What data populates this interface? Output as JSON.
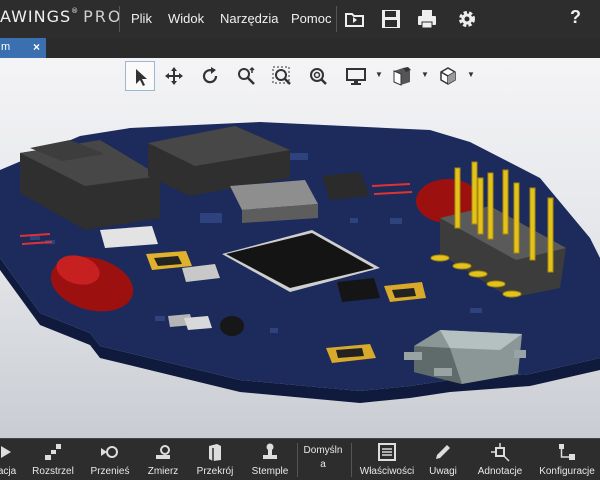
{
  "app": {
    "logo_main": "AWINGS",
    "logo_sup": "®",
    "logo_pro": "PRO"
  },
  "menu": {
    "items": [
      "Plik",
      "Widok",
      "Narzędzia",
      "Pomoc"
    ]
  },
  "toolbar": {
    "icons": [
      "open-folder-icon",
      "save-icon",
      "print-icon",
      "gear-icon"
    ],
    "help_label": "?"
  },
  "tab": {
    "label": "m",
    "close_label": "×"
  },
  "view_toolbar": {
    "tools": [
      "select-pointer-icon",
      "pan-icon",
      "rotate-icon",
      "zoom-icon",
      "zoom-window-icon",
      "zoom-fit-icon",
      "display-mode-icon",
      "render-mode-icon",
      "view-cube-icon"
    ]
  },
  "ribbon": {
    "items": [
      {
        "label": "acja",
        "icon": "animation-icon"
      },
      {
        "label": "Rozstrzel",
        "icon": "explode-icon"
      },
      {
        "label": "Przenieś",
        "icon": "move-icon"
      },
      {
        "label": "Zmierz",
        "icon": "measure-icon"
      },
      {
        "label": "Przekrój",
        "icon": "section-icon"
      },
      {
        "label": "Stemple",
        "icon": "stamp-icon"
      },
      {
        "label": "Domyśln\na",
        "icon": ""
      },
      {
        "label": "Właściwości",
        "icon": "properties-icon"
      },
      {
        "label": "Uwagi",
        "icon": "pencil-icon"
      },
      {
        "label": "Adnotacje",
        "icon": "annotation-icon"
      },
      {
        "label": "Konfiguracje",
        "icon": "configuration-icon"
      }
    ]
  },
  "colors": {
    "background": "#2b2b2b",
    "tab_active": "#3a6fb0",
    "pcb": "#1b2a55",
    "pin_gold": "#e3c21b"
  }
}
